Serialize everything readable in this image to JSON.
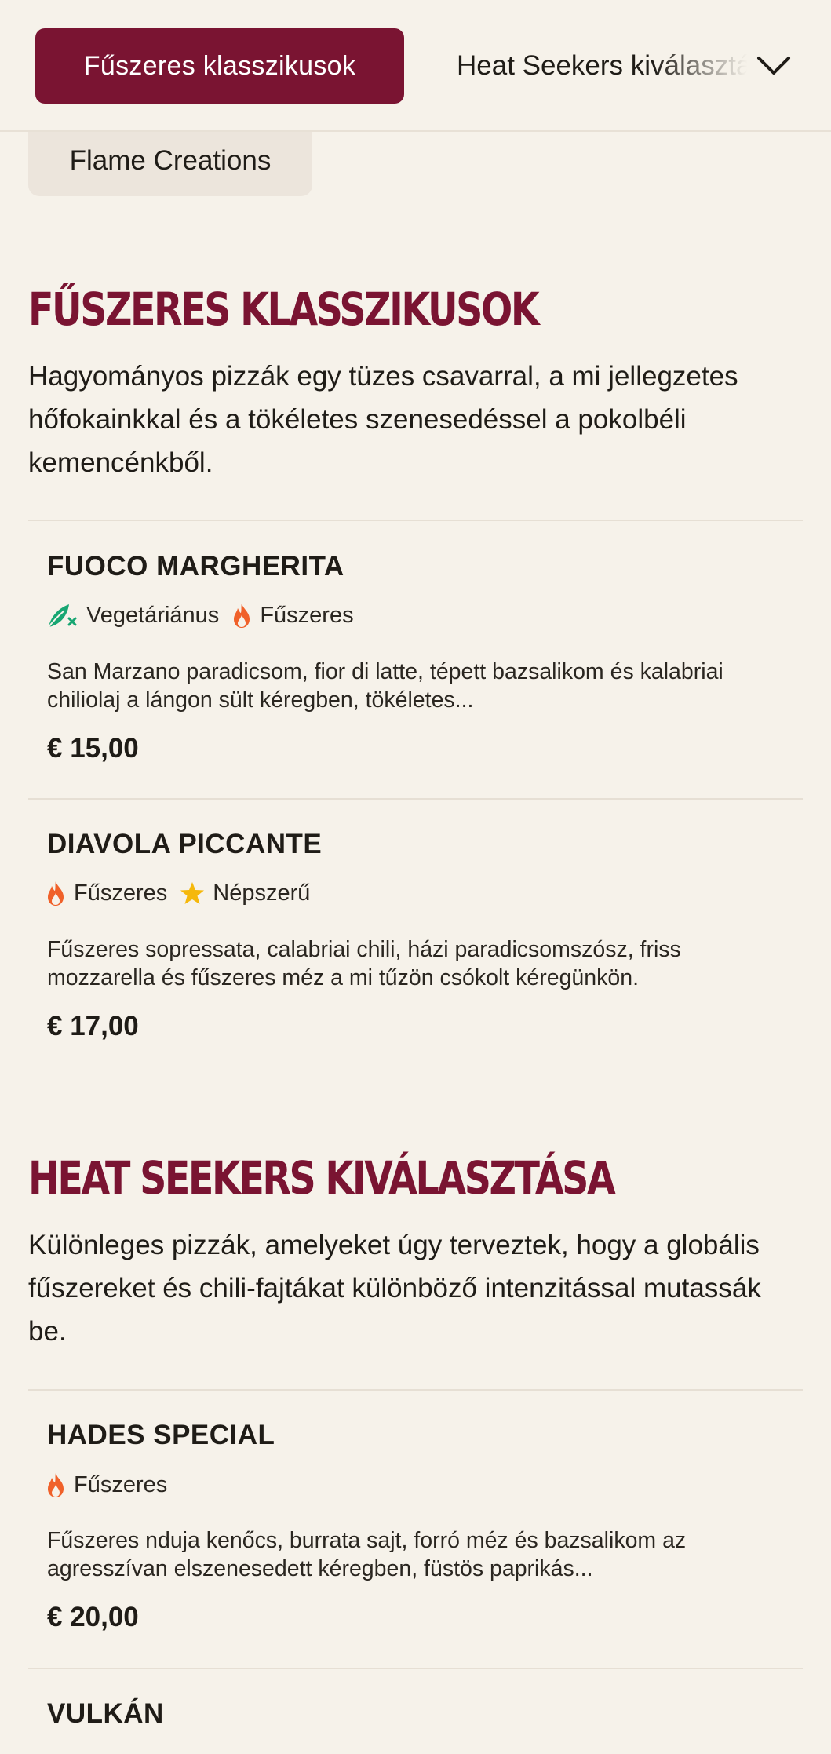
{
  "nav": {
    "active_tab": "Fűszeres klasszikusok",
    "next_tab": "Heat Seekers kiválasztása",
    "flame_tab": "Flame Creations"
  },
  "colors": {
    "accent": "#7a1432",
    "background": "#f6f2ea",
    "fire": "#f0612a",
    "star": "#f5b80b",
    "veg": "#17a672"
  },
  "sections": [
    {
      "title": "FŰSZERES KLASSZIKUSOK",
      "description": "Hagyományos pizzák egy tüzes csavarral, a mi jellegzetes hőfokainkkal és a tökéletes szenesedéssel a pokolbéli kemencénkből.",
      "items": [
        {
          "name": "FUOCO MARGHERITA",
          "tags": [
            {
              "icon": "leaf-icon",
              "label": "Vegetáriánus"
            },
            {
              "icon": "flame-icon",
              "label": "Fűszeres"
            }
          ],
          "description": "San Marzano paradicsom, fior di latte, tépett bazsalikom és kalabriai chiliolaj a lángon sült kéregben, tökéletes...",
          "price": "€ 15,00"
        },
        {
          "name": "DIAVOLA PICCANTE",
          "tags": [
            {
              "icon": "flame-icon",
              "label": "Fűszeres"
            },
            {
              "icon": "star-icon",
              "label": "Népszerű"
            }
          ],
          "description": "Fűszeres sopressata, calabriai chili, házi paradicsomszósz, friss mozzarella és fűszeres méz a mi tűzön csókolt kéregünkön.",
          "price": "€ 17,00"
        }
      ]
    },
    {
      "title": "HEAT SEEKERS KIVÁLASZTÁSA",
      "description": "Különleges pizzák, amelyeket úgy terveztek, hogy a globális fűszereket és chili-fajtákat különböző intenzitással mutassák be.",
      "items": [
        {
          "name": "HADES SPECIAL",
          "tags": [
            {
              "icon": "flame-icon",
              "label": "Fűszeres"
            }
          ],
          "description": "Fűszeres nduja kenőcs, burrata sajt, forró méz és bazsalikom az agresszívan elszenesedett kéregben, füstös paprikás...",
          "price": "€ 20,00"
        },
        {
          "name": "VULKÁN"
        }
      ]
    }
  ]
}
